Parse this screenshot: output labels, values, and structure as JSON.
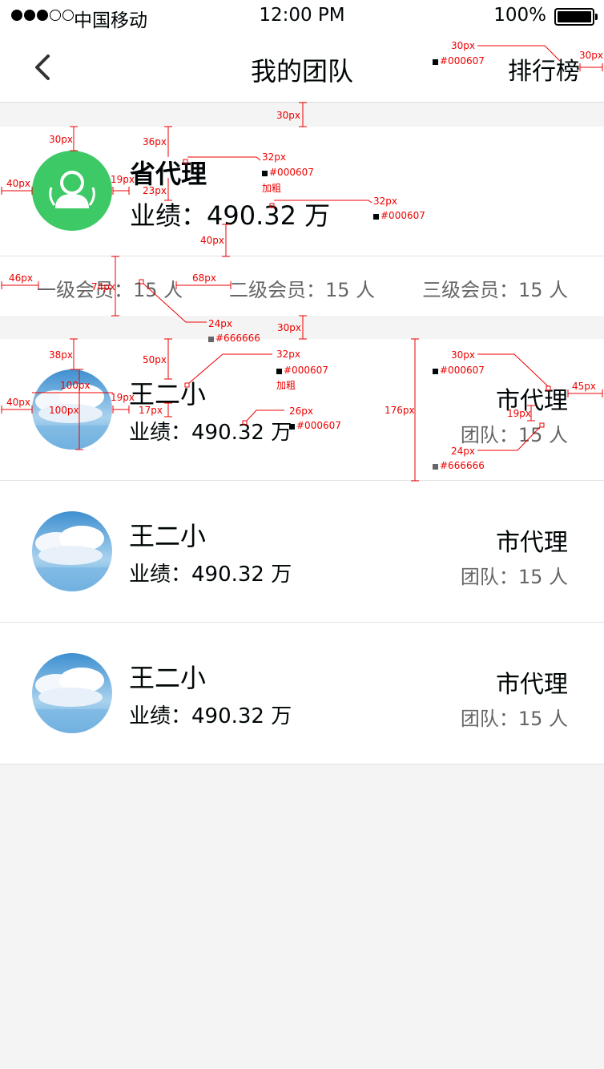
{
  "status_bar": {
    "carrier": "中国移动",
    "time": "12:00 PM",
    "battery": "100%",
    "signal_icon": "signal-dots-icon",
    "battery_icon": "battery-icon"
  },
  "nav": {
    "back_icon": "chevron-left-icon",
    "title": "我的团队",
    "rank_label": "排行榜"
  },
  "self": {
    "avatar_icon": "user-avatar-icon",
    "avatar_color": "#3dc965",
    "name": "省代理",
    "performance": "业绩：490.32 万"
  },
  "members": [
    {
      "label": "一级会员：15 人"
    },
    {
      "label": "二级会员：15 人"
    },
    {
      "label": "三级会员：15 人"
    }
  ],
  "team": [
    {
      "name": "王二小",
      "performance": "业绩：490.32 万",
      "level": "市代理",
      "team": "团队：15 人"
    },
    {
      "name": "王二小",
      "performance": "业绩：490.32 万",
      "level": "市代理",
      "team": "团队：15 人"
    },
    {
      "name": "王二小",
      "performance": "业绩：490.32 万",
      "level": "市代理",
      "team": "团队：15 人"
    }
  ],
  "annotations": {
    "a1": "30px",
    "a2": "#000607",
    "a3": "30px",
    "a4": "30px",
    "a5": "30px",
    "a6": "36px",
    "a7": "32px",
    "a8": "#000607",
    "a9": "加粗",
    "a10": "40px",
    "a11": "19px",
    "a12": "23px",
    "a13": "32px",
    "a14": "#000607",
    "a15": "40px",
    "a16": "46px",
    "a17": "74px",
    "a18": "68px",
    "a19": "24px",
    "a20": "#666666",
    "a21": "30px",
    "a22": "38px",
    "a23": "50px",
    "a24": "32px",
    "a25": "#000607",
    "a26": "加粗",
    "a27": "40px",
    "a28": "100px",
    "a29": "100px",
    "a30": "19px",
    "a31": "17px",
    "a32": "26px",
    "a33": "#000607",
    "a34": "176px",
    "a35": "30px",
    "a36": "#000607",
    "a37": "45px",
    "a38": "19px",
    "a39": "24px",
    "a40": "#666666"
  },
  "colors": {
    "text": "#000607",
    "secondary": "#666666",
    "annotation": "#e00000",
    "background": "#f4f4f4"
  }
}
